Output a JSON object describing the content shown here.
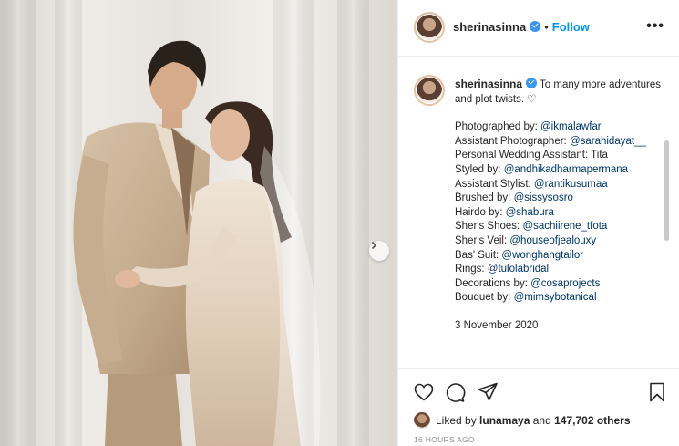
{
  "post": {
    "username": "sherinasinna",
    "dot": "•",
    "follow_label": "Follow",
    "more_label": "•••"
  },
  "caption": {
    "username": "sherinasinna",
    "text": "To many more adventures and plot twists. ♡",
    "lines": [
      {
        "label": "Photographed by: ",
        "mention": "@ikmalawfar"
      },
      {
        "label": "Assistant Photographer: ",
        "mention": "@sarahidayat__"
      },
      {
        "label": "Personal Wedding Assistant: Tita",
        "mention": ""
      },
      {
        "label": "Styled by: ",
        "mention": "@andhikadharmapermana"
      },
      {
        "label": "Assistant Stylist: ",
        "mention": "@rantikusumaa"
      },
      {
        "label": "Brushed by: ",
        "mention": "@sissysosro"
      },
      {
        "label": "Hairdo by: ",
        "mention": "@shabura"
      },
      {
        "label": "Sher's Shoes: ",
        "mention": "@sachiirene_tfota"
      },
      {
        "label": "Sher's Veil: ",
        "mention": "@houseofjealouxy"
      },
      {
        "label": "Bas' Suit: ",
        "mention": "@wonghangtailor"
      },
      {
        "label": "Rings: ",
        "mention": "@tulolabridal"
      },
      {
        "label": "Decorations by: ",
        "mention": "@cosaprojects"
      },
      {
        "label": "Bouquet by: ",
        "mention": "@mimsybotanical"
      }
    ],
    "date": "3 November 2020"
  },
  "likes": {
    "prefix": "Liked by ",
    "user": "lunamaya",
    "middle": " and ",
    "count": "147,702 others"
  },
  "timestamp": "16 HOURS AGO",
  "icons": [
    "verified-badge-icon",
    "heart-icon",
    "comment-icon",
    "share-icon",
    "bookmark-icon",
    "chevron-right-icon"
  ],
  "colors": {
    "accent": "#0095f6",
    "mention": "#00376b",
    "verified": "#3897f0"
  }
}
